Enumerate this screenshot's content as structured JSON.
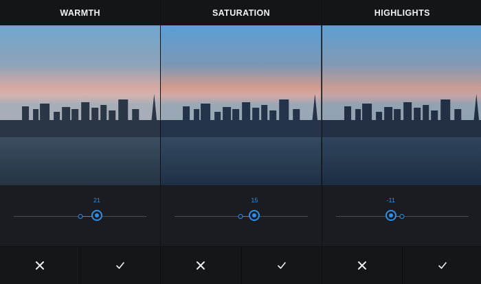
{
  "colors": {
    "accent": "#2e8fe6",
    "header_bg": "#141519",
    "panel_bg": "#1b1c21"
  },
  "panels": [
    {
      "title": "WARMTH",
      "value": "21",
      "level": 0.55,
      "cancel_icon": "close-icon",
      "confirm_icon": "checkmark-icon"
    },
    {
      "title": "SATURATION",
      "value": "15",
      "level": 0.6,
      "cancel_icon": "close-icon",
      "confirm_icon": "checkmark-icon"
    },
    {
      "title": "HIGHLIGHTS",
      "value": "-11",
      "level": 0.4,
      "cancel_icon": "close-icon",
      "confirm_icon": "checkmark-icon"
    }
  ]
}
